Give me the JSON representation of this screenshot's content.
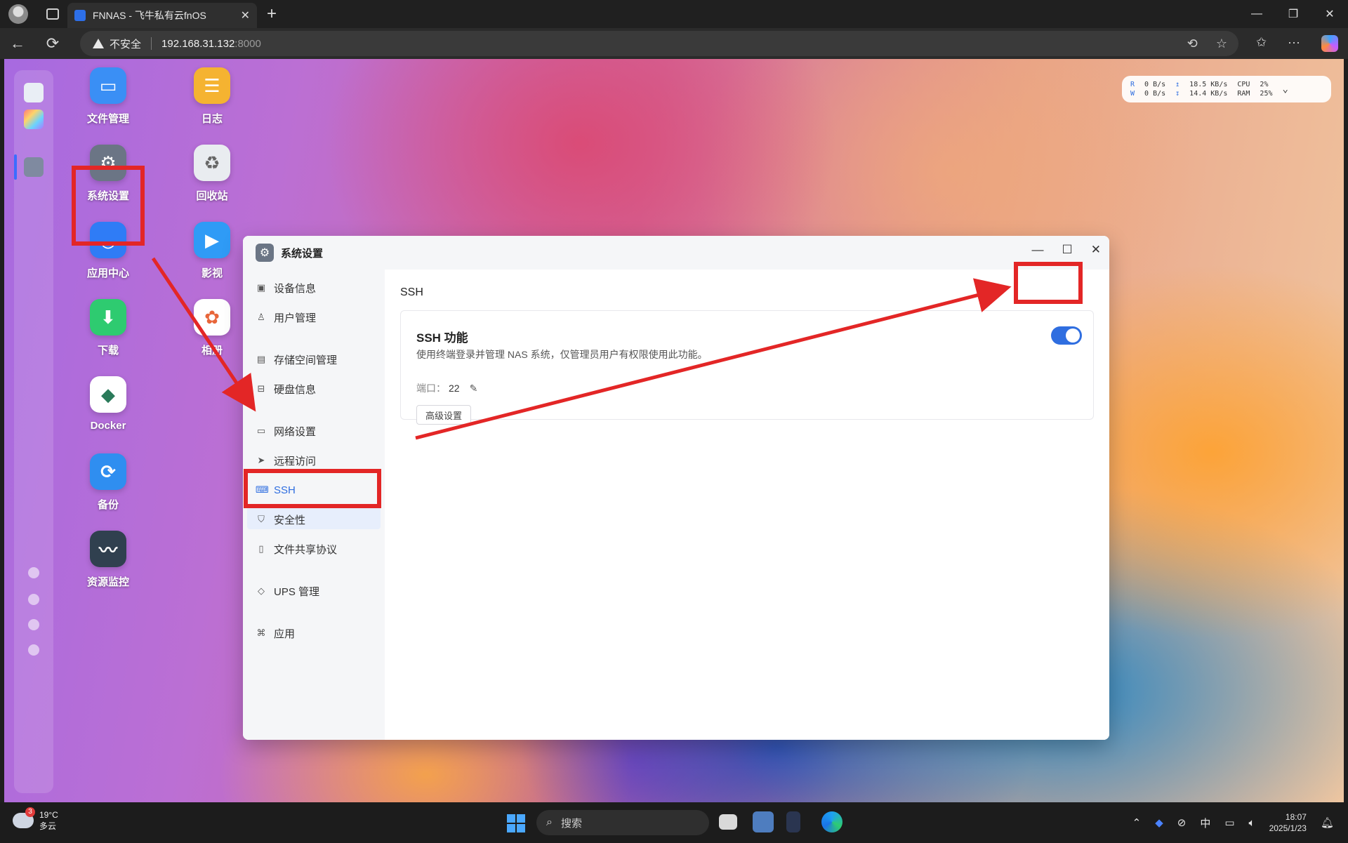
{
  "browser": {
    "tab_title": "FNNAS - 飞牛私有云fnOS",
    "insecure_label": "不安全",
    "url_host": "192.168.31.132",
    "url_port": ":8000"
  },
  "desktop": {
    "icons": [
      {
        "label": "文件管理",
        "icon": "folder-icon",
        "color": "#3a8ff5"
      },
      {
        "label": "日志",
        "icon": "log-icon",
        "color": "#f5b331"
      },
      {
        "label": "系统设置",
        "icon": "gear-icon",
        "color": "#6b7585"
      },
      {
        "label": "回收站",
        "icon": "recycle-icon",
        "color": "#e9ecf0"
      },
      {
        "label": "应用中心",
        "icon": "store-icon",
        "color": "#2f7cf6"
      },
      {
        "label": "影视",
        "icon": "video-icon",
        "color": "#2f9bf6"
      },
      {
        "label": "下载",
        "icon": "download-icon",
        "color": "#2ecb70"
      },
      {
        "label": "相册",
        "icon": "photos-icon",
        "color": "#ffffff"
      },
      {
        "label": "Docker",
        "icon": "docker-icon",
        "color": "#ffffff"
      },
      {
        "label": "备份",
        "icon": "backup-icon",
        "color": "#2f8ef0"
      },
      {
        "label": "资源监控",
        "icon": "monitor-icon",
        "color": "#30404f"
      }
    ]
  },
  "sysmon": {
    "r": "R",
    "w": "W",
    "r_rate": "0  B/s",
    "w_rate": "0  B/s",
    "up": "18.5 KB/s",
    "down": "14.4 KB/s",
    "cpu_label": "CPU",
    "ram_label": "RAM",
    "cpu": "2%",
    "ram": "25%"
  },
  "settings": {
    "title": "系统设置",
    "nav": [
      {
        "label": "设备信息",
        "icon": "device-icon"
      },
      {
        "label": "用户管理",
        "icon": "user-icon"
      },
      {
        "label": "存储空间管理",
        "icon": "storage-icon"
      },
      {
        "label": "硬盘信息",
        "icon": "disk-icon"
      },
      {
        "label": "网络设置",
        "icon": "network-icon"
      },
      {
        "label": "远程访问",
        "icon": "remote-icon"
      },
      {
        "label": "SSH",
        "icon": "ssh-icon",
        "active": true
      },
      {
        "label": "安全性",
        "icon": "shield-icon"
      },
      {
        "label": "文件共享协议",
        "icon": "file-share-icon"
      },
      {
        "label": "UPS 管理",
        "icon": "ups-icon"
      },
      {
        "label": "应用",
        "icon": "apps-icon"
      }
    ],
    "section_title": "SSH",
    "ssh_title": "SSH 功能",
    "ssh_desc": "使用终端登录并管理 NAS 系统，仅管理员用户有权限使用此功能。",
    "port_label": "端口：",
    "port_value": "22",
    "advanced_label": "高级设置",
    "ssh_enabled": true
  },
  "taskbar": {
    "weather_badge": "3",
    "temperature": "19°C",
    "condition": "多云",
    "search_placeholder": "搜索",
    "ime": "中",
    "time": "18:07",
    "date": "2025/1/23"
  },
  "colors": {
    "accent": "#2f6ee0",
    "annotation": "#e32626"
  }
}
